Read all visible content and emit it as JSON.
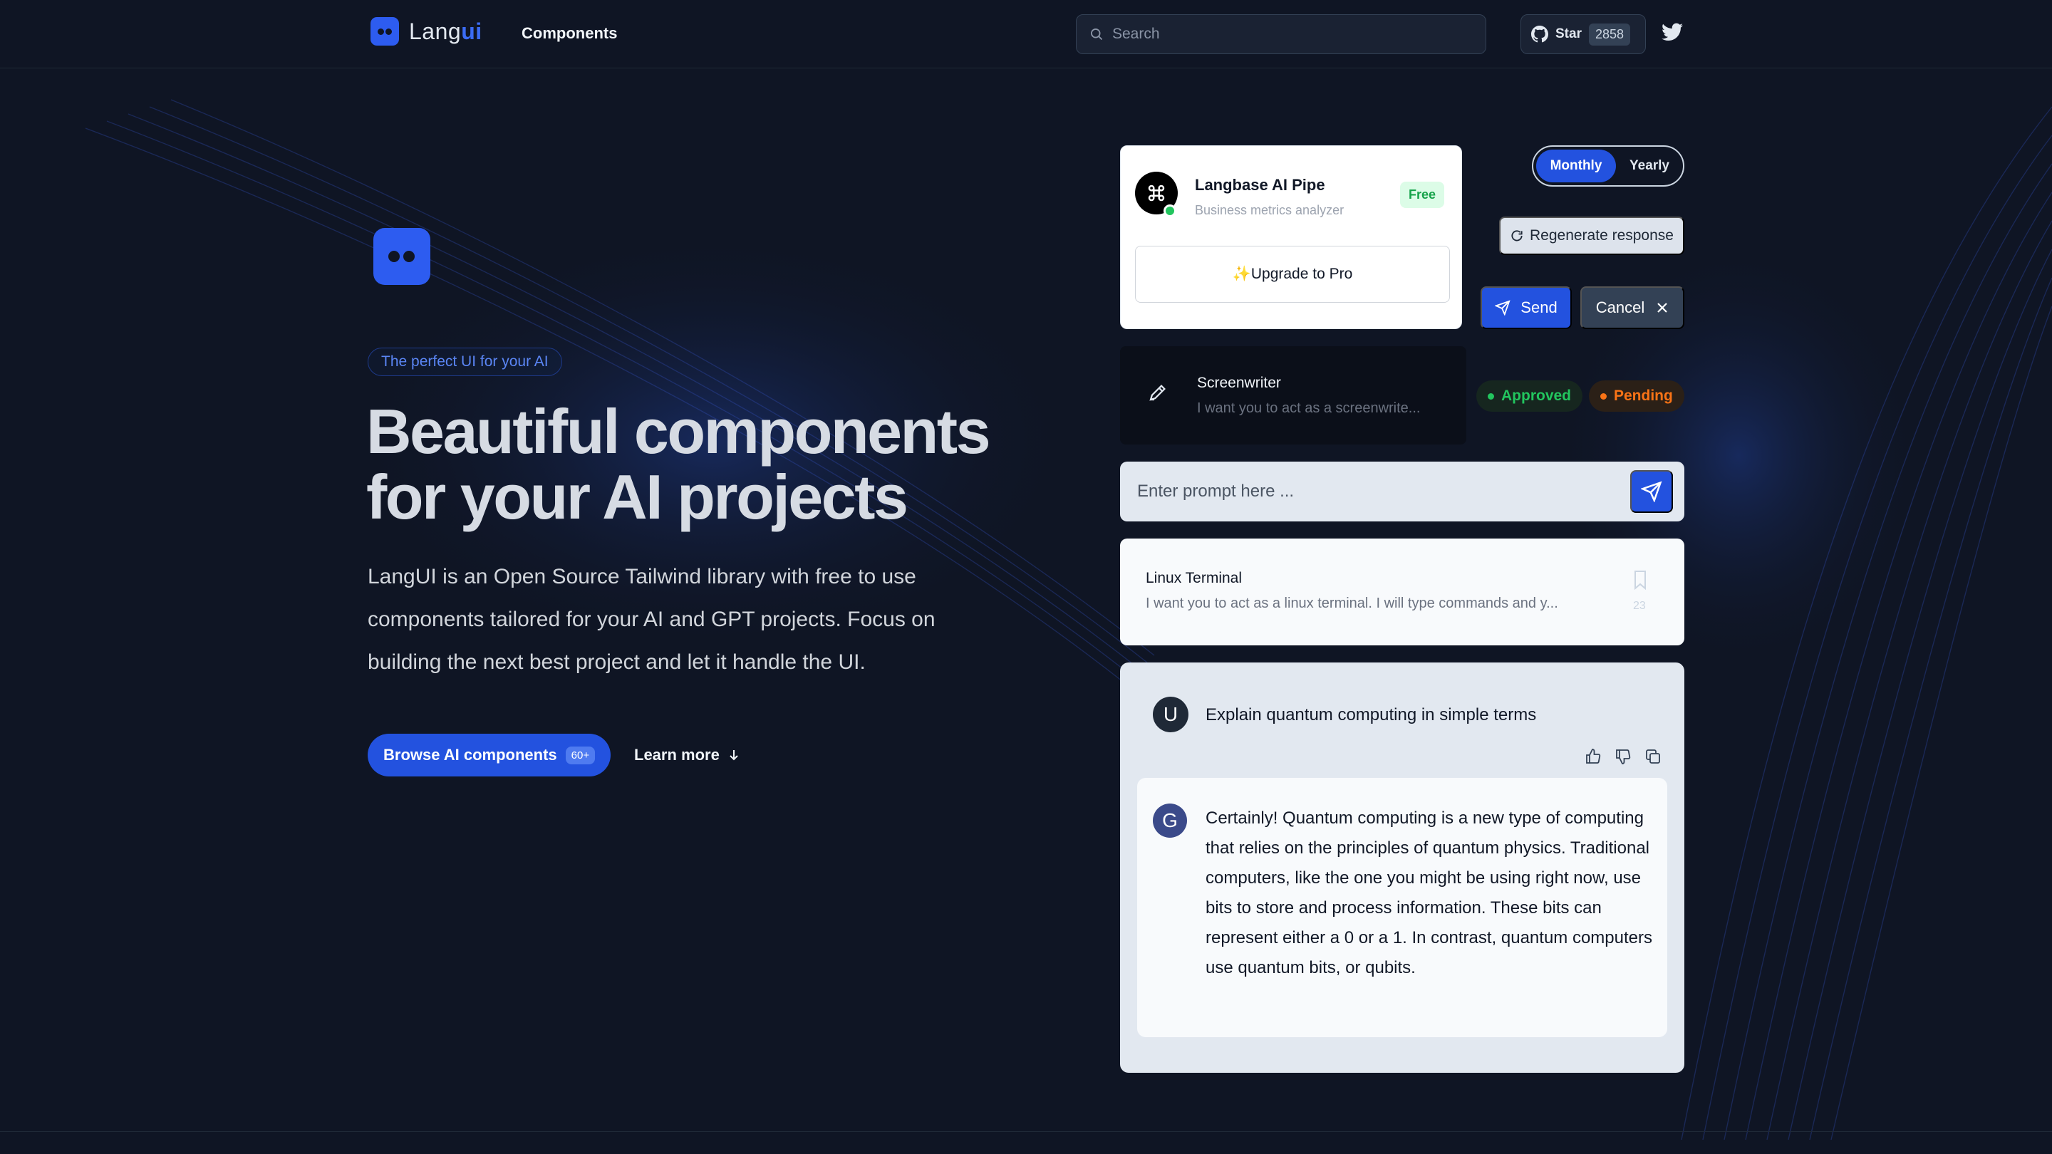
{
  "colors": {
    "background": "#0f1524",
    "accent": "#2352df",
    "brand": "#2d5cf0",
    "approved": "#22c55e",
    "pending": "#f97316"
  },
  "header": {
    "logo_prefix": "Lang",
    "logo_suffix": "ui",
    "nav_components": "Components",
    "search_placeholder": "Search",
    "github_label": "Star",
    "github_count": "2858",
    "icons": [
      "logo-icon",
      "search-icon",
      "github-icon",
      "twitter-icon"
    ]
  },
  "hero": {
    "tagline": "The perfect UI for your AI",
    "title_line1": "Beautiful components",
    "title_line2": "for your AI projects",
    "description": "LangUI is an Open Source Tailwind library with free to use components tailored for your AI and GPT projects. Focus on building the next best project and let it handle the UI.",
    "browse_label": "Browse AI components",
    "browse_badge": "60+",
    "learn_label": "Learn more"
  },
  "pipe_card": {
    "title": "Langbase AI Pipe",
    "subtitle": "Business metrics analyzer",
    "badge": "Free",
    "upgrade_label": "✨Upgrade to Pro"
  },
  "billing_toggle": {
    "monthly": "Monthly",
    "yearly": "Yearly",
    "selected": "Monthly"
  },
  "actions": {
    "regenerate": "Regenerate response",
    "send": "Send",
    "cancel": "Cancel"
  },
  "screenwriter": {
    "title": "Screenwriter",
    "subtitle": "I want you to act as a screenwrite..."
  },
  "statuses": {
    "approved": "Approved",
    "pending": "Pending"
  },
  "prompt": {
    "placeholder": "Enter prompt here ..."
  },
  "linux_card": {
    "title": "Linux Terminal",
    "subtitle": "I want you to act as a linux terminal. I will type commands and y...",
    "count": "23"
  },
  "chat": {
    "user_initial": "U",
    "question": "Explain quantum computing in simple terms",
    "bot_initial": "G",
    "answer": "Certainly! Quantum computing is a new type of computing that relies on the principles of quantum physics. Traditional computers, like the one you might be using right now, use bits to store and process information. These bits can represent either a 0 or a 1. In contrast, quantum computers use quantum bits, or qubits."
  }
}
